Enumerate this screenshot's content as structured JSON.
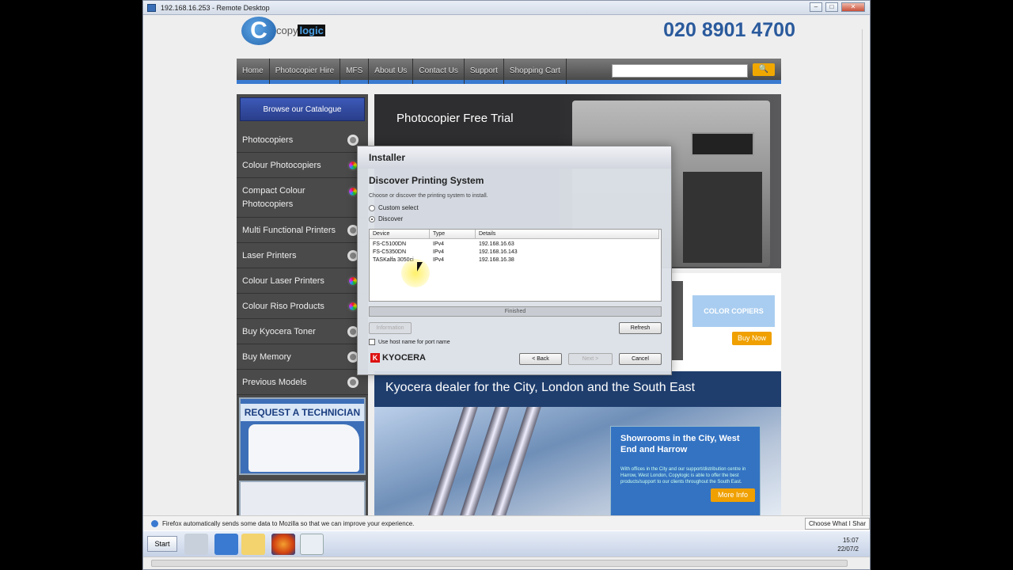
{
  "window": {
    "title": "192.168.16.253 - Remote Desktop"
  },
  "site": {
    "logo_prefix": "copy",
    "logo_suffix": "logic",
    "phone": "020 8901 4700",
    "nav": [
      "Home",
      "Photocopier Hire",
      "MFS",
      "About Us",
      "Contact Us",
      "Support",
      "Shopping Cart"
    ],
    "search_button": "Q",
    "catalogue_button": "Browse our Catalogue",
    "sidebar": [
      {
        "label": "Photocopiers",
        "colour": false
      },
      {
        "label": "Colour Photocopiers",
        "colour": true
      },
      {
        "label": "Compact Colour Photocopiers",
        "colour": true
      },
      {
        "label": "Multi Functional Printers",
        "colour": false
      },
      {
        "label": "Laser Printers",
        "colour": false
      },
      {
        "label": "Colour Laser Printers",
        "colour": true
      },
      {
        "label": "Colour Riso Products",
        "colour": true
      },
      {
        "label": "Buy Kyocera Toner",
        "colour": false
      },
      {
        "label": "Buy Memory",
        "colour": false
      },
      {
        "label": "Previous Models",
        "colour": false
      }
    ],
    "request_technician": "REQUEST A TECHNICIAN",
    "hero_title": "Photocopier Free Trial",
    "color_copiers": "COLOR COPIERS",
    "buy_now": "Buy Now",
    "dealer": "Kyocera dealer for the City, London and the South East",
    "showrooms_title": "Showrooms in the City, West End and Harrow",
    "showrooms_text": "With offices in the City and our support/distribution centre in Harrow, West London, Copylogic is able to offer the best products/support to our clients throughout the South East.",
    "more_info": "More Info"
  },
  "dialog": {
    "title": "Installer",
    "heading": "Discover Printing System",
    "instruction": "Choose or discover the printing system to install.",
    "radio_custom": "Custom select",
    "radio_discover": "Discover",
    "columns": [
      "Device",
      "Type",
      "Details"
    ],
    "rows": [
      {
        "device": "FS-C5100DN",
        "type": "IPv4",
        "details": "192.168.16.63"
      },
      {
        "device": "FS-C5350DN",
        "type": "IPv4",
        "details": "192.168.16.143"
      },
      {
        "device": "TASKalfa 3050ci",
        "type": "IPv4",
        "details": "192.168.16.38"
      }
    ],
    "progress": "Finished",
    "information_button": "Information",
    "refresh_button": "Refresh",
    "hostname_label": "Use host name for port name",
    "brand": "KYOCERA",
    "back_button": "< Back",
    "next_button": "Next >",
    "cancel_button": "Cancel"
  },
  "infobar": {
    "text": "Firefox automatically sends some data to Mozilla so that we can improve your experience.",
    "choose_button": "Choose What I Shar"
  },
  "taskbar": {
    "start": "Start",
    "time": "15:07",
    "date": "22/07/2"
  }
}
